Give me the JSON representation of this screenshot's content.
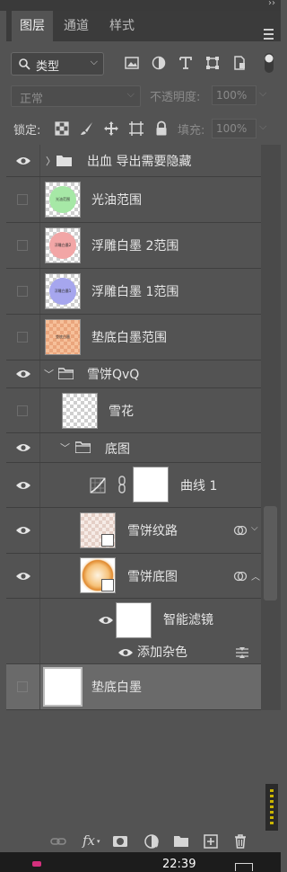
{
  "panel": {
    "tabs": [
      {
        "label": "图层",
        "active": true
      },
      {
        "label": "通道",
        "active": false
      },
      {
        "label": "样式",
        "active": false
      }
    ]
  },
  "filter": {
    "kind_label": "类型"
  },
  "blend": {
    "mode": "正常",
    "opacity_label": "不透明度:",
    "opacity_value": "100%"
  },
  "lock": {
    "label": "锁定:",
    "fill_label": "填充:",
    "fill_value": "100%"
  },
  "layers": [
    {
      "name": "出血 导出需要隐藏",
      "type": "group",
      "visible": true
    },
    {
      "name": "光油范围",
      "type": "pixel",
      "visible": false,
      "thumb_color": "#a6e8a6",
      "thumb_text": "光油范围"
    },
    {
      "name": "浮雕白墨 2范围",
      "type": "pixel",
      "visible": false,
      "thumb_color": "#f2a6a6",
      "thumb_text": "浮雕白墨2"
    },
    {
      "name": "浮雕白墨 1范围",
      "type": "pixel",
      "visible": false,
      "thumb_color": "#a6a6ee",
      "thumb_text": "浮雕白墨1"
    },
    {
      "name": "垫底白墨范围",
      "type": "pixel",
      "visible": false,
      "thumb_color": "#f6c09a",
      "thumb_text": "垫底白墨"
    },
    {
      "name": "雪饼QvQ",
      "type": "group",
      "visible": true
    },
    {
      "name": "雪花",
      "type": "pixel",
      "visible": false
    },
    {
      "name": "底图",
      "type": "group",
      "visible": true
    },
    {
      "name": "曲线 1",
      "type": "adjustment",
      "visible": true
    },
    {
      "name": "雪饼纹路",
      "type": "smart",
      "visible": true
    },
    {
      "name": "雪饼底图",
      "type": "smart",
      "visible": true
    },
    {
      "name": "智能滤镜",
      "type": "filter-mask",
      "visible": true
    },
    {
      "name": "添加杂色",
      "type": "filter",
      "visible": true
    },
    {
      "name": "垫底白墨",
      "type": "pixel",
      "visible": false,
      "selected": true
    }
  ],
  "status": {
    "time": "22:39"
  },
  "colors": {
    "panel_bg": "#535353",
    "tab_bg": "#3b3b3b",
    "selected_row": "#6a6a6a"
  }
}
